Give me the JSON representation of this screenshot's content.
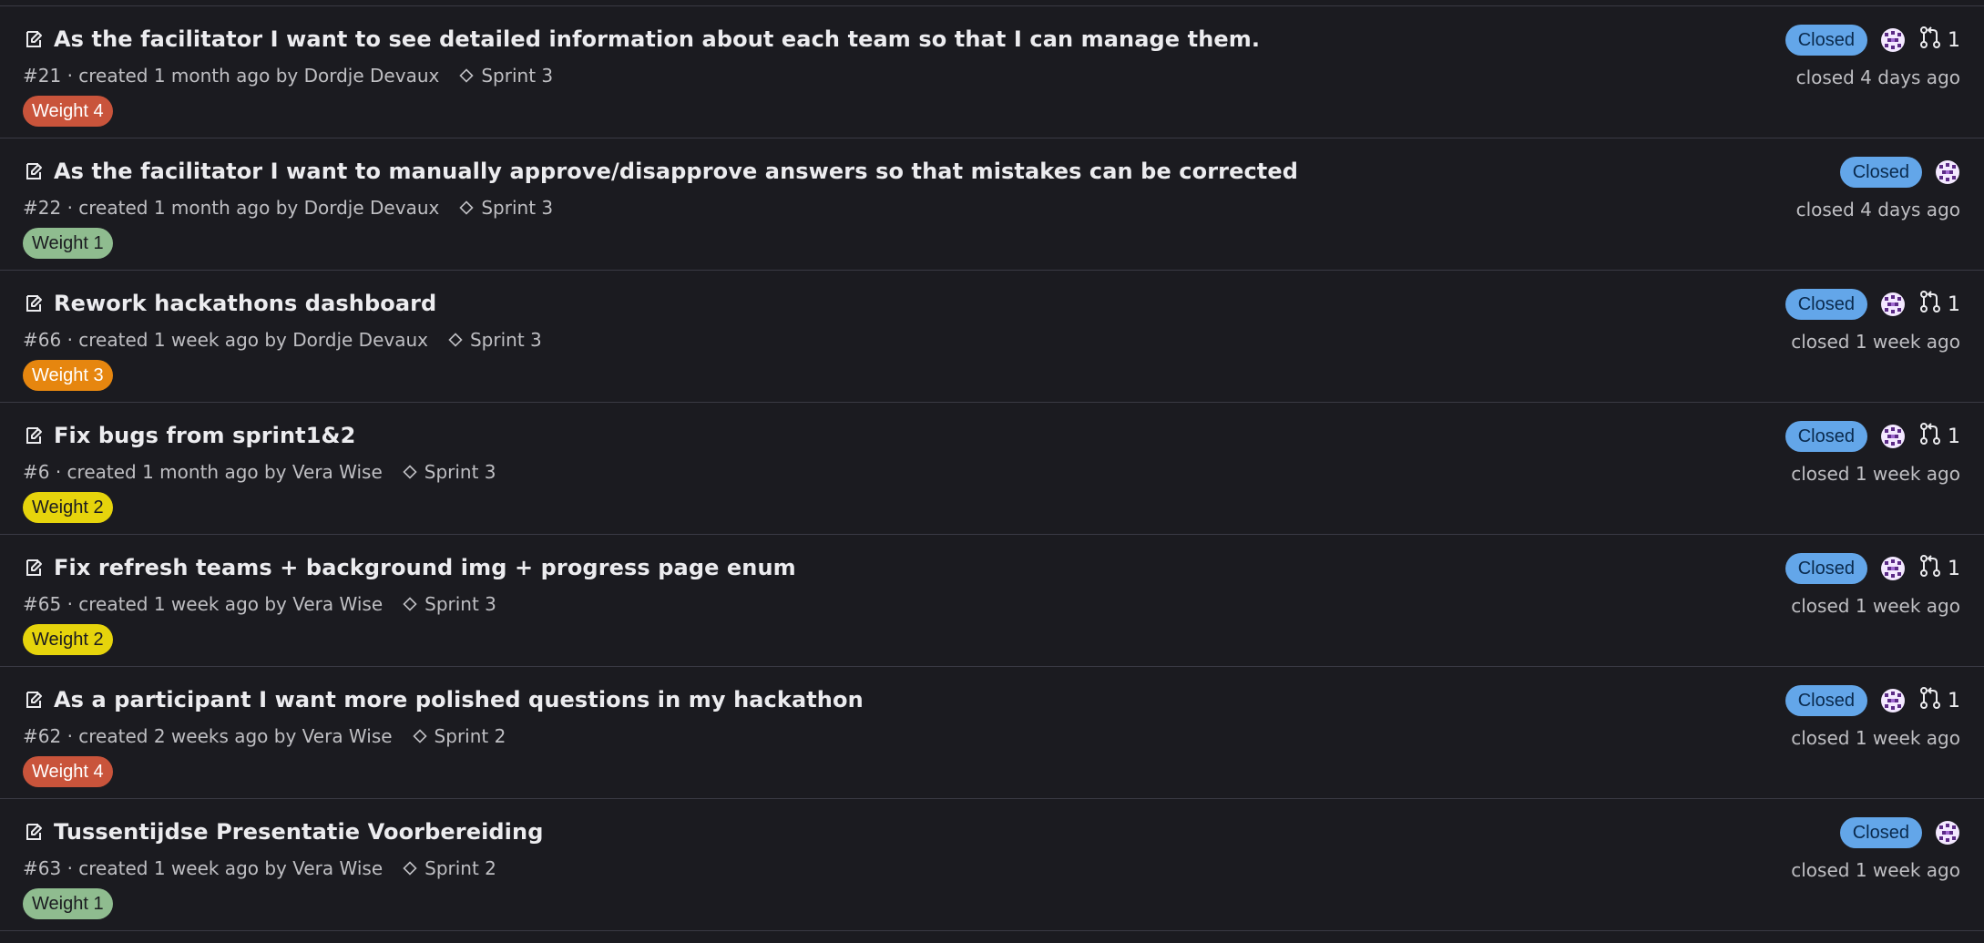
{
  "issues": [
    {
      "title": "As the facilitator I want to see detailed information about each team so that I can manage them.",
      "meta": "#21 · created 1 month ago by Dordje Devaux",
      "milestone": "Sprint 3",
      "weight": "Weight 4",
      "weight_bg": "#c9543b",
      "weight_fg": "#ffffff",
      "status": "Closed",
      "mr_count": "1",
      "closed": "closed 4 days ago"
    },
    {
      "title": "As the facilitator I want to manually approve/disapprove answers so that mistakes can be corrected",
      "meta": "#22 · created 1 month ago by Dordje Devaux",
      "milestone": "Sprint 3",
      "weight": "Weight 1",
      "weight_bg": "#8fbc8f",
      "weight_fg": "#1b1b20",
      "status": "Closed",
      "mr_count": null,
      "closed": "closed 4 days ago"
    },
    {
      "title": "Rework hackathons dashboard",
      "meta": "#66 · created 1 week ago by Dordje Devaux",
      "milestone": "Sprint 3",
      "weight": "Weight 3",
      "weight_bg": "#e6860f",
      "weight_fg": "#ffffff",
      "status": "Closed",
      "mr_count": "1",
      "closed": "closed 1 week ago"
    },
    {
      "title": "Fix bugs from sprint1&2",
      "meta": "#6 · created 1 month ago by Vera Wise",
      "milestone": "Sprint 3",
      "weight": "Weight 2",
      "weight_bg": "#e6d40c",
      "weight_fg": "#1b1b20",
      "status": "Closed",
      "mr_count": "1",
      "closed": "closed 1 week ago"
    },
    {
      "title": "Fix refresh teams + background img + progress page enum",
      "meta": "#65 · created 1 week ago by Vera Wise",
      "milestone": "Sprint 3",
      "weight": "Weight 2",
      "weight_bg": "#e6d40c",
      "weight_fg": "#1b1b20",
      "status": "Closed",
      "mr_count": "1",
      "closed": "closed 1 week ago"
    },
    {
      "title": "As a participant I want more polished questions in my hackathon",
      "meta": "#62 · created 2 weeks ago by Vera Wise",
      "milestone": "Sprint 2",
      "weight": "Weight 4",
      "weight_bg": "#c9543b",
      "weight_fg": "#ffffff",
      "status": "Closed",
      "mr_count": "1",
      "closed": "closed 1 week ago"
    },
    {
      "title": "Tussentijdse Presentatie Voorbereiding",
      "meta": "#63 · created 1 week ago by Vera Wise",
      "milestone": "Sprint 2",
      "weight": "Weight 1",
      "weight_bg": "#8fbc8f",
      "weight_fg": "#1b1b20",
      "status": "Closed",
      "mr_count": null,
      "closed": "closed 1 week ago"
    }
  ],
  "icons": {
    "issue": "issue-icon",
    "milestone": "milestone-icon",
    "assignee": "assignee-avatar-icon",
    "merge_request": "merge-request-icon"
  },
  "colors": {
    "background": "#1b1b20",
    "status_closed_bg": "#63a6e9",
    "text_primary": "#ececef",
    "text_secondary": "#bfbfc3"
  }
}
